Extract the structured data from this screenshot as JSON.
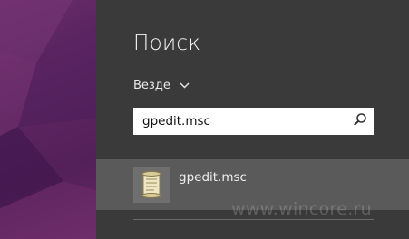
{
  "charm": {
    "title": "Поиск",
    "scope_label": "Везде",
    "search": {
      "value": "gpedit.msc",
      "placeholder": ""
    }
  },
  "results": [
    {
      "label": "gpedit.msc",
      "icon": "scroll-icon"
    }
  ],
  "watermark": "www.wincore.ru",
  "colors": {
    "panel_bg": "#3a3a3a",
    "selected_result_bg": "#5a5a5a",
    "accent_purple": "#5c2660"
  }
}
